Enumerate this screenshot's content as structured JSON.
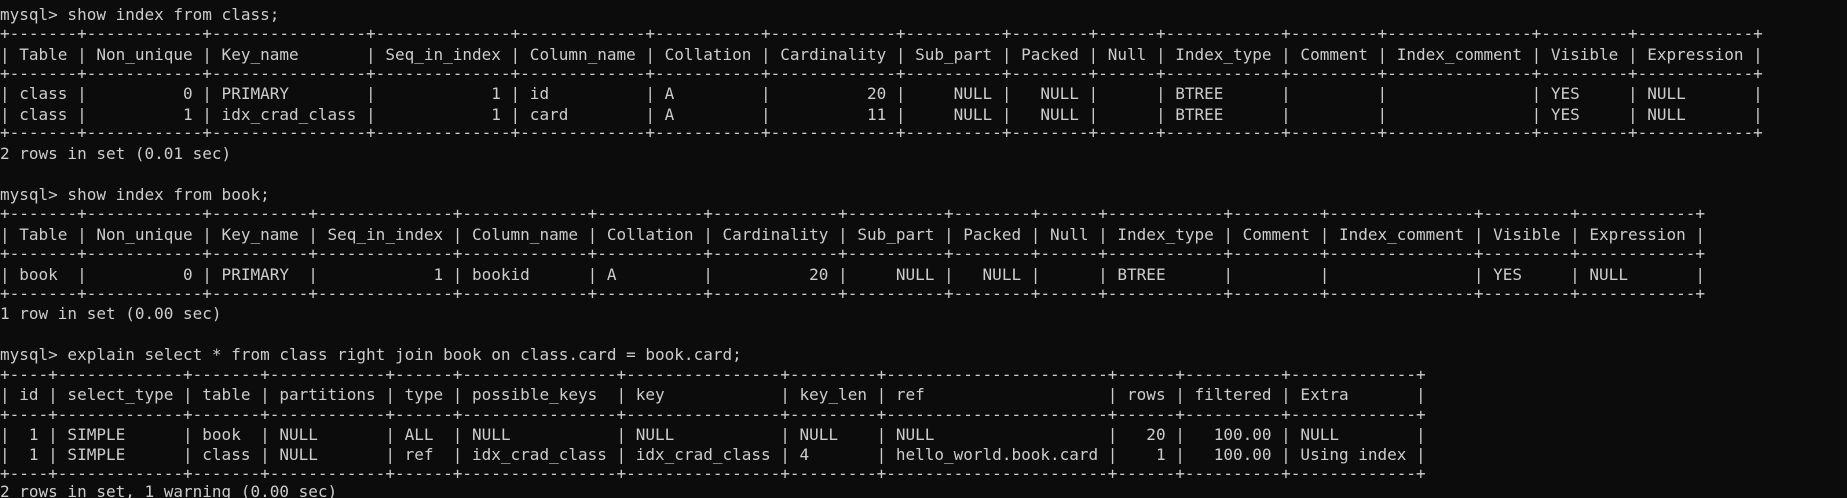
{
  "colors": {
    "background": "#0c0c0c",
    "text": "#cccccc"
  },
  "terminal": {
    "lines": [
      "mysql> show index from class;",
      "+-------+------------+----------------+--------------+-------------+-----------+-------------+----------+--------+------+------------+---------+---------------+---------+------------+",
      "| Table | Non_unique | Key_name       | Seq_in_index | Column_name | Collation | Cardinality | Sub_part | Packed | Null | Index_type | Comment | Index_comment | Visible | Expression |",
      "+-------+------------+----------------+--------------+-------------+-----------+-------------+----------+--------+------+------------+---------+---------------+---------+------------+",
      "| class |          0 | PRIMARY        |            1 | id          | A         |          20 |     NULL |   NULL |      | BTREE      |         |               | YES     | NULL       |",
      "| class |          1 | idx_crad_class |            1 | card        | A         |          11 |     NULL |   NULL |      | BTREE      |         |               | YES     | NULL       |",
      "+-------+------------+----------------+--------------+-------------+-----------+-------------+----------+--------+------+------------+---------+---------------+---------+------------+",
      "2 rows in set (0.01 sec)",
      "mysql> show index from book;",
      "+-------+------------+----------+--------------+-------------+-----------+-------------+----------+--------+------+------------+---------+---------------+---------+------------+",
      "| Table | Non_unique | Key_name | Seq_in_index | Column_name | Collation | Cardinality | Sub_part | Packed | Null | Index_type | Comment | Index_comment | Visible | Expression |",
      "+-------+------------+----------+--------------+-------------+-----------+-------------+----------+--------+------+------------+---------+---------------+---------+------------+",
      "| book  |          0 | PRIMARY  |            1 | bookid      | A         |          20 |     NULL |   NULL |      | BTREE      |         |               | YES     | NULL       |",
      "+-------+------------+----------+--------------+-------------+-----------+-------------+----------+--------+------+------------+---------+---------------+---------+------------+",
      "1 row in set (0.00 sec)",
      "mysql> explain select * from class right join book on class.card = book.card;",
      "+----+-------------+-------+------------+------+----------------+----------------+---------+-----------------------+------+----------+-------------+",
      "| id | select_type | table | partitions | type | possible_keys  | key            | key_len | ref                   | rows | filtered | Extra       |",
      "+----+-------------+-------+------------+------+----------------+----------------+---------+-----------------------+------+----------+-------------+",
      "|  1 | SIMPLE      | book  | NULL       | ALL  | NULL           | NULL           | NULL    | NULL                  |   20 |   100.00 | NULL        |",
      "|  1 | SIMPLE      | class | NULL       | ref  | idx_crad_class | idx_crad_class | 4       | hello_world.book.card |    1 |   100.00 | Using index |",
      "+----+-------------+-------+------------+------+----------------+----------------+---------+-----------------------+------+----------+-------------+",
      "2 rows in set, 1 warning (0.00 sec)"
    ]
  }
}
